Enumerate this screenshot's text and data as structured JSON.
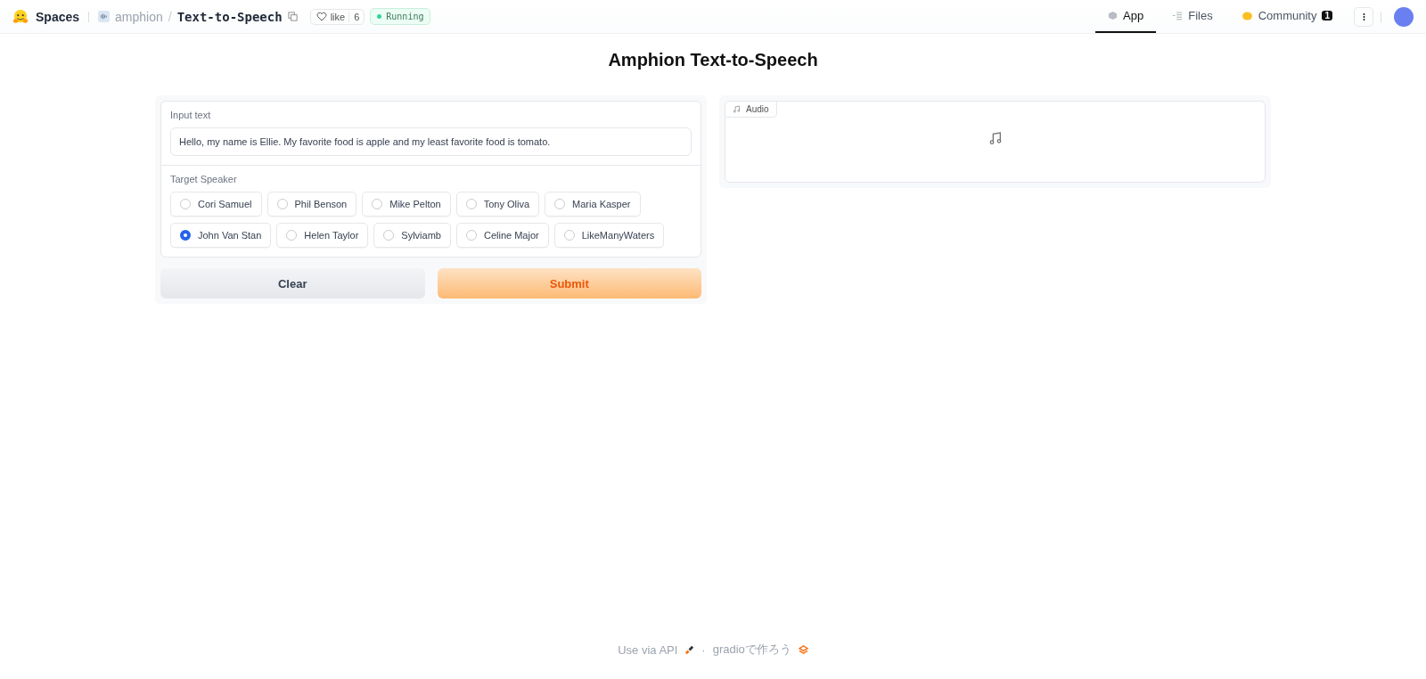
{
  "header": {
    "brand": "Spaces",
    "owner": "amphion",
    "separator": "/",
    "repo": "Text-to-Speech",
    "like": {
      "label": "like",
      "count": "6"
    },
    "status": "Running",
    "tabs": [
      {
        "label": "App",
        "selected": true,
        "kind": "app"
      },
      {
        "label": "Files",
        "selected": false,
        "kind": "files"
      },
      {
        "label": "Community",
        "selected": false,
        "kind": "community",
        "badge": "1"
      }
    ]
  },
  "title": "Amphion Text-to-Speech",
  "input": {
    "label": "Input text",
    "value": "Hello, my name is Ellie. My favorite food is apple and my least favorite food is tomato."
  },
  "speaker": {
    "label": "Target Speaker",
    "options": [
      {
        "label": "Cori Samuel",
        "selected": false
      },
      {
        "label": "Phil Benson",
        "selected": false
      },
      {
        "label": "Mike Pelton",
        "selected": false
      },
      {
        "label": "Tony Oliva",
        "selected": false
      },
      {
        "label": "Maria Kasper",
        "selected": false
      },
      {
        "label": "John Van Stan",
        "selected": true
      },
      {
        "label": "Helen Taylor",
        "selected": false
      },
      {
        "label": "Sylviamb",
        "selected": false
      },
      {
        "label": "Celine Major",
        "selected": false
      },
      {
        "label": "LikeManyWaters",
        "selected": false
      }
    ]
  },
  "buttons": {
    "clear": "Clear",
    "submit": "Submit"
  },
  "output": {
    "label": "Audio"
  },
  "footer": {
    "api": "Use via API",
    "dot": "·",
    "built": "gradioで作ろう"
  }
}
